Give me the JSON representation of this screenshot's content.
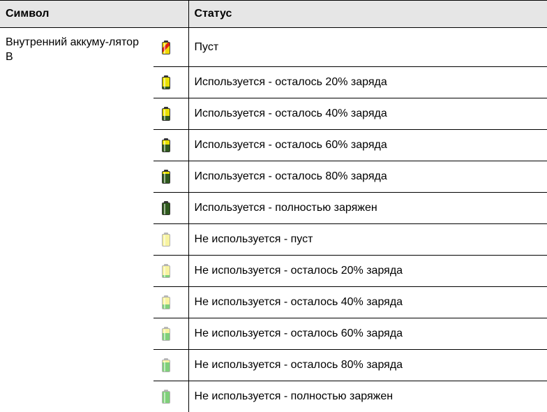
{
  "table": {
    "header": {
      "symbol": "Символ",
      "status": "Статус"
    },
    "group_label": "Внутренний аккуму-лятор B",
    "rows": [
      {
        "icon": "battery-empty-warning-icon",
        "status": "Пуст",
        "in_use": true,
        "level": -1
      },
      {
        "icon": "battery-in-use-20-icon",
        "status": "Используется - осталось 20% заряда",
        "in_use": true,
        "level": 0.2
      },
      {
        "icon": "battery-in-use-40-icon",
        "status": "Используется - осталось 40% заряда",
        "in_use": true,
        "level": 0.4
      },
      {
        "icon": "battery-in-use-60-icon",
        "status": "Используется - осталось 60% заряда",
        "in_use": true,
        "level": 0.6
      },
      {
        "icon": "battery-in-use-80-icon",
        "status": "Используется - осталось 80% заряда",
        "in_use": true,
        "level": 0.8
      },
      {
        "icon": "battery-in-use-full-icon",
        "status": "Используется - полностью заряжен",
        "in_use": true,
        "level": 1.0
      },
      {
        "icon": "battery-not-in-use-empty-icon",
        "status": "Не используется - пуст",
        "in_use": false,
        "level": 0
      },
      {
        "icon": "battery-not-in-use-20-icon",
        "status": "Не используется - осталось 20% заряда",
        "in_use": false,
        "level": 0.2
      },
      {
        "icon": "battery-not-in-use-40-icon",
        "status": "Не используется - осталось 40% заряда",
        "in_use": false,
        "level": 0.4
      },
      {
        "icon": "battery-not-in-use-60-icon",
        "status": "Не используется - осталось 60% заряда",
        "in_use": false,
        "level": 0.6
      },
      {
        "icon": "battery-not-in-use-80-icon",
        "status": "Не используется - осталось 80% заряда",
        "in_use": false,
        "level": 0.8
      },
      {
        "icon": "battery-not-in-use-full-icon",
        "status": "Не используется - полностью заряжен",
        "in_use": false,
        "level": 1.0
      }
    ]
  },
  "colors": {
    "header_bg": "#e6e6e6",
    "in_use_body": "#e8e000",
    "in_use_fill": "#2f5a1e",
    "not_in_use_body": "#f7f3a0",
    "not_in_use_fill": "#7fd07a",
    "empty_warning_yellow": "#f0d800",
    "empty_warning_red": "#e02010"
  }
}
